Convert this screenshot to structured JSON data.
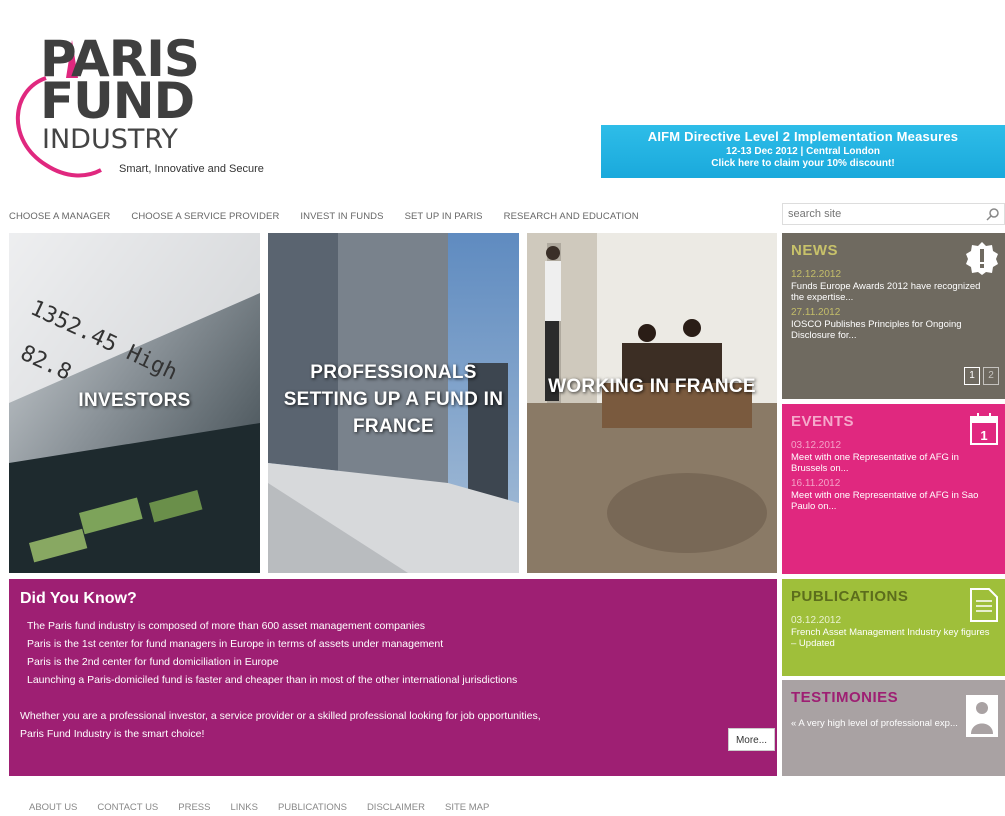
{
  "logo": {
    "line1": "PARIS",
    "line2": "FUND",
    "line3": "INDUSTRY",
    "tagline": "Smart, Innovative and Secure"
  },
  "banner": {
    "title": "AIFM Directive Level 2 Implementation Measures",
    "date": "12-13 Dec 2012 | Central London",
    "cta": "Click here to claim your 10% discount!"
  },
  "nav": [
    "CHOOSE A MANAGER",
    "CHOOSE A SERVICE PROVIDER",
    "INVEST IN FUNDS",
    "SET UP IN PARIS",
    "RESEARCH AND EDUCATION"
  ],
  "search": {
    "placeholder": "search site"
  },
  "tiles": [
    {
      "label": "INVESTORS"
    },
    {
      "label": "PROFESSIONALS SETTING UP A FUND IN FRANCE"
    },
    {
      "label": "WORKING IN FRANCE"
    }
  ],
  "did_you_know": {
    "title": "Did You Know?",
    "facts": [
      "The Paris fund industry is composed of more than 600 asset management companies",
      "Paris is the 1st center for fund managers in Europe in terms of assets under management",
      "Paris is the 2nd center for fund domiciliation in Europe",
      "Launching a Paris-domiciled fund is faster and cheaper than in most of the other international jurisdictions"
    ],
    "closing_line1": "Whether you are a professional investor, a service provider or a skilled professional looking for job opportunities,",
    "closing_line2": "Paris Fund Industry is the smart choice!",
    "more_label": "More..."
  },
  "news": {
    "title": "NEWS",
    "items": [
      {
        "date": "12.12.2012",
        "text": "Funds Europe Awards 2012 have recognized the expertise..."
      },
      {
        "date": "27.11.2012",
        "text": "IOSCO Publishes Principles for Ongoing Disclosure for..."
      }
    ],
    "pages": [
      "1",
      "2"
    ]
  },
  "events": {
    "title": "EVENTS",
    "items": [
      {
        "date": "03.12.2012",
        "text": "Meet with one Representative of AFG in Brussels on..."
      },
      {
        "date": "16.11.2012",
        "text": "Meet with one Representative of AFG in Sao Paulo on..."
      }
    ]
  },
  "publications": {
    "title": "PUBLICATIONS",
    "items": [
      {
        "date": "03.12.2012",
        "text": "French Asset Management Industry key figures – Updated"
      }
    ]
  },
  "testimonies": {
    "title": "TESTIMONIES",
    "items": [
      {
        "text": "« A very high level of professional exp..."
      }
    ]
  },
  "footer": [
    "ABOUT US",
    "CONTACT US",
    "PRESS",
    "LINKS",
    "PUBLICATIONS",
    "DISCLAIMER",
    "SITE MAP"
  ],
  "colors": {
    "banner": "#1aa9dc",
    "did_you_know": "#9e1f73",
    "news": "#6f6a60",
    "events": "#e0287f",
    "publications": "#9fbf3a",
    "testimonies": "#a9a2a3",
    "logo_accent": "#e0287f"
  }
}
